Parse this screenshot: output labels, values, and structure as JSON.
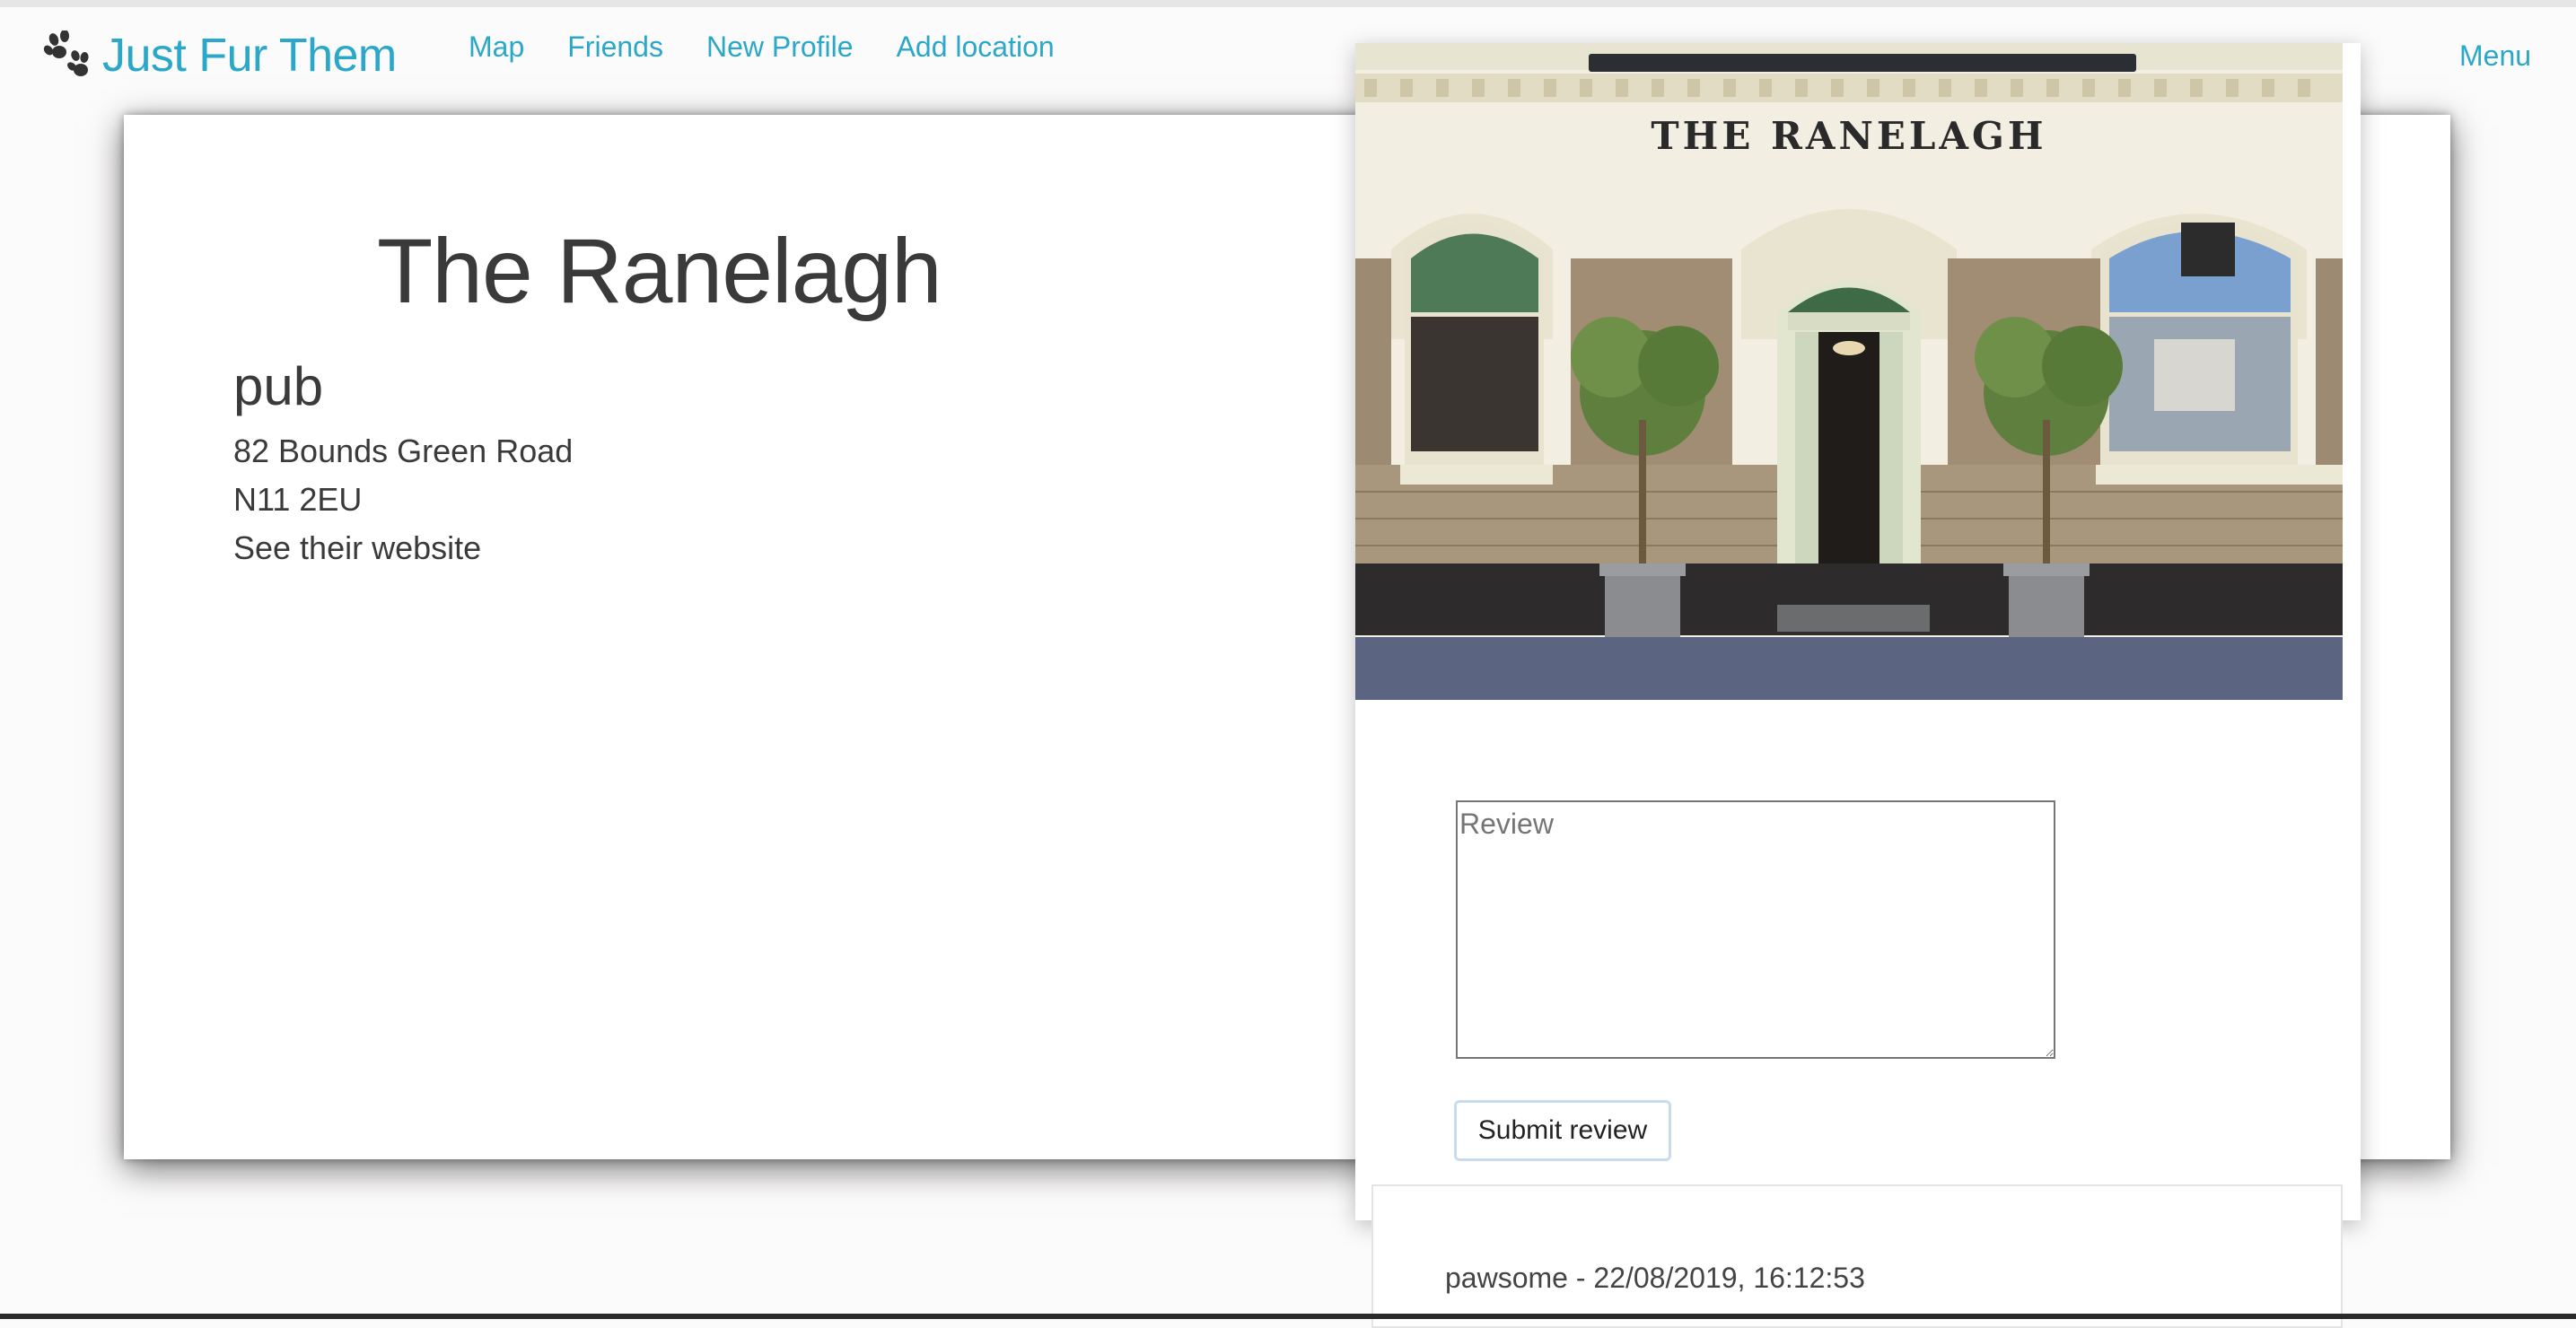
{
  "nav": {
    "brand": "Just Fur Them",
    "links": [
      "Map",
      "Friends",
      "New Profile",
      "Add location"
    ],
    "menu": "Menu"
  },
  "location": {
    "name": "The Ranelagh",
    "category": "pub",
    "address_line1": "82 Bounds Green Road",
    "postcode": "N11 2EU",
    "website_link": "See their website"
  },
  "photo": {
    "sign_text": "THE RANELAGH"
  },
  "review_form": {
    "placeholder": "Review",
    "submit_label": "Submit review"
  },
  "reviews": [
    {
      "meta": "pawsome - 22/08/2019, 16:12:53"
    }
  ],
  "colors": {
    "accent": "#2aa7c9",
    "text": "#3a3a3a"
  }
}
